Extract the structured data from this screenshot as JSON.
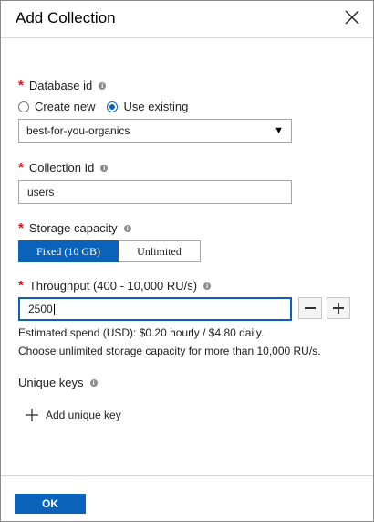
{
  "header": {
    "title": "Add Collection"
  },
  "database": {
    "label": "Database id",
    "radio_create": "Create new",
    "radio_existing": "Use existing",
    "selected_radio": "Use existing",
    "selected_value": "best-for-you-organics"
  },
  "collection": {
    "label": "Collection Id",
    "value": "users"
  },
  "storage": {
    "label": "Storage capacity",
    "options": [
      "Fixed (10 GB)",
      "Unlimited"
    ],
    "selected": "Fixed (10 GB)"
  },
  "throughput": {
    "label": "Throughput (400 - 10,000 RU/s)",
    "value": "2500",
    "estimate": "Estimated spend (USD): $0.20 hourly / $4.80 daily.",
    "note": "Choose unlimited storage capacity for more than 10,000 RU/s."
  },
  "unique_keys": {
    "label": "Unique keys",
    "add_label": "Add unique key"
  },
  "footer": {
    "ok_label": "OK"
  },
  "colors": {
    "accent": "#0a62ba",
    "required": "#e00b1c"
  },
  "icons": {
    "close": "close-icon",
    "info": "info-icon",
    "dropdown": "caret-down-icon",
    "minus": "minus-icon",
    "plus": "plus-icon",
    "add": "plus-icon"
  }
}
